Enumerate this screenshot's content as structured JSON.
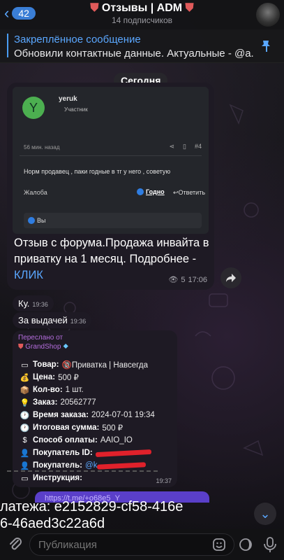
{
  "header": {
    "back_count": "42",
    "title": "Отзывы | ADM",
    "subscribers": "14 подписчиков"
  },
  "pinned": {
    "label": "Закреплённое сообщение",
    "text": "Обновили контактные данные. Актуальные - @a..."
  },
  "date_pill": "Сегодня",
  "forum": {
    "avatar_letter": "Y",
    "username": "yeruk",
    "role": "Участник",
    "posted": "56 мин. назад",
    "post_number": "#4",
    "review_text": "Норм продавец , паки годные в тг у него , советую",
    "complain": "Жалоба",
    "good": "Годно",
    "reply": "Ответить",
    "reaction_you": "Вы",
    "caption": "Отзыв с форума.Продажа инвайта в приватку на 1 месяц. Подробнее - ",
    "caption_link": "КЛИК",
    "views": "5",
    "time": "17:06"
  },
  "messages": [
    {
      "text": "Ку.",
      "time": "19:36"
    },
    {
      "text": "За выдачей",
      "time": "19:36"
    }
  ],
  "order": {
    "forwarded_from": "Переслано от",
    "shop_name": "GrandShop",
    "lines": [
      {
        "icon": "▭",
        "key": "Товар:",
        "value": "🔞Приватка | Навсегда"
      },
      {
        "icon": "💰",
        "key": "Цена:",
        "value": "500 ₽"
      },
      {
        "icon": "📦",
        "key": "Кол-во:",
        "value": "1 шт."
      },
      {
        "icon": "💡",
        "key": "Заказ:",
        "value": "20562777"
      },
      {
        "icon": "🕐",
        "key": "Время заказа:",
        "value": "2024-07-01 19:34"
      },
      {
        "icon": "🕐",
        "key": "Итоговая сумма:",
        "value": "500 ₽"
      },
      {
        "icon": "$",
        "key": "Способ оплаты:",
        "value": "AAIO_IO"
      },
      {
        "icon": "👤",
        "key": "Покупатель ID:",
        "value": ""
      },
      {
        "icon": "👤",
        "key": "Покупатель:",
        "value": "@k"
      },
      {
        "icon": "▭",
        "key": "Инструкция:",
        "value": ""
      }
    ],
    "time": "19:37"
  },
  "link_preview": "https://t.me/+o68e5_Y",
  "overlay_text_1": "латежа: e2152829-cf58-416e",
  "overlay_text_2": "6-46aed3c22a6d",
  "composer": {
    "placeholder": "Публикация"
  },
  "colors": {
    "accent": "#5aa7ff",
    "bubble": "#1e1a24",
    "forward": "#b46ddd",
    "redact": "#e0212b"
  }
}
